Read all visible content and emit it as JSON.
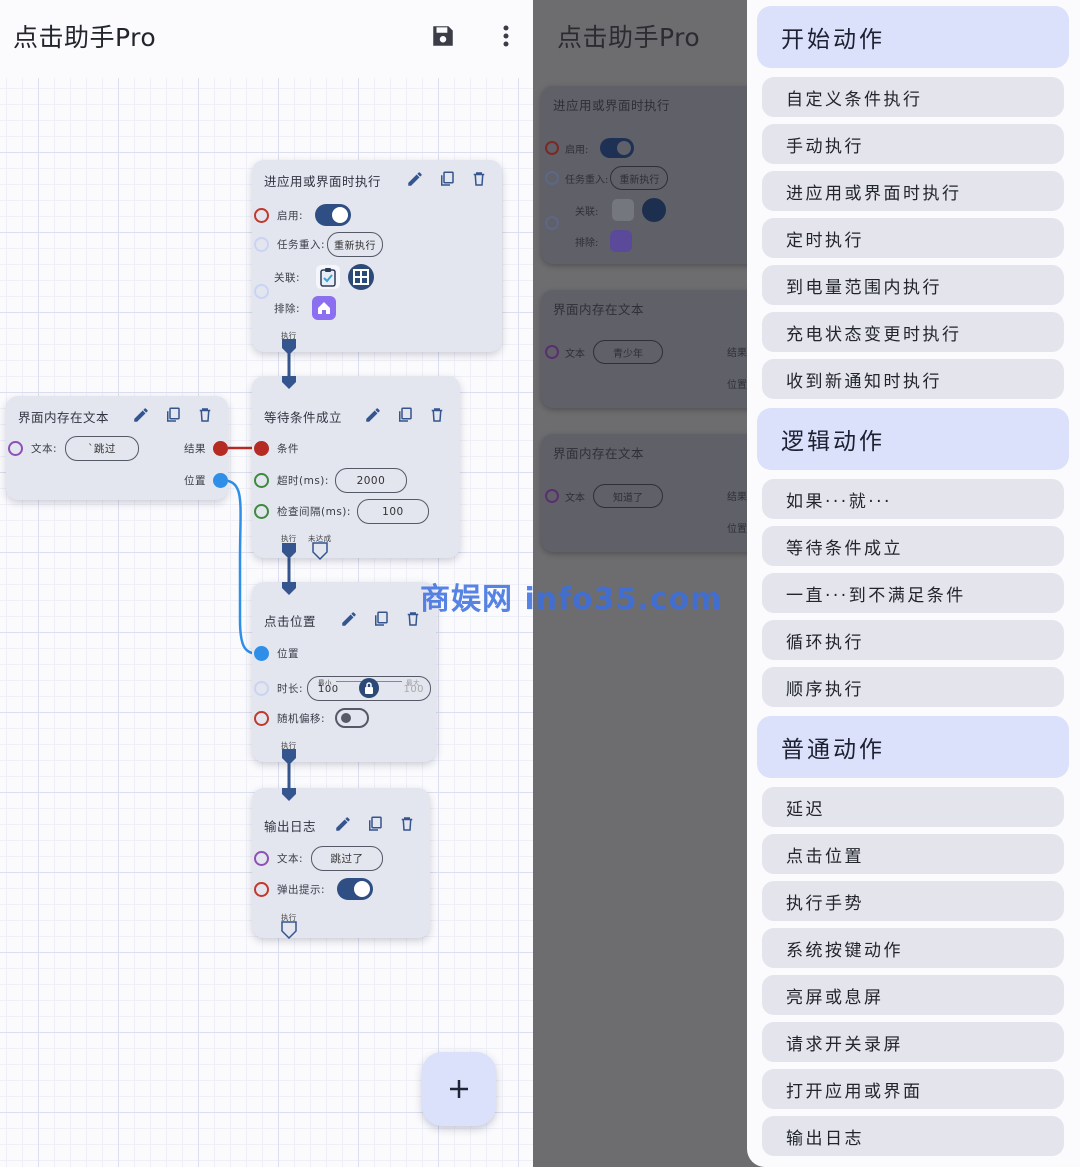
{
  "app": {
    "title": "点击助手Pro",
    "save_icon": "save-icon",
    "more_icon": "more-vert-icon"
  },
  "colors": {
    "accent": "#2f4f84",
    "drawer_header": "#dbe0fb",
    "red_port": "#c0392b",
    "blue_port": "#2f8fe8",
    "green_port": "#3d8a3d",
    "purple_port": "#8e4fb8"
  },
  "nodes": {
    "enter_app": {
      "title": "进应用或界面时执行",
      "enable_label": "启用:",
      "reentry_label": "任务重入:",
      "reentry_value": "重新执行",
      "related_label": "关联:",
      "exclude_label": "排除:",
      "exec_label": "执行"
    },
    "screen_text": {
      "title": "界面内存在文本",
      "text_label": "文本:",
      "text_value": "`跳过",
      "result_label": "结果",
      "position_label": "位置"
    },
    "wait": {
      "title": "等待条件成立",
      "condition_label": "条件",
      "timeout_label": "超时(ms):",
      "timeout_value": "2000",
      "interval_label": "检查间隔(ms):",
      "interval_value": "100",
      "exec_label": "执行",
      "fail_label": "未达成"
    },
    "click": {
      "title": "点击位置",
      "position_label": "位置",
      "duration_label": "时长:",
      "min_label": "最小",
      "max_label": "最大",
      "min_value": "100",
      "max_value": "100",
      "offset_label": "随机偏移:",
      "exec_label": "执行"
    },
    "log": {
      "title": "输出日志",
      "text_label": "文本:",
      "text_value": "跳过了",
      "popup_label": "弹出提示:",
      "exec_label": "执行"
    }
  },
  "fab": {
    "icon": "plus-icon"
  },
  "background_screen": {
    "title": "点击助手Pro",
    "node1": {
      "title": "进应用或界面时执行",
      "enable_label": "启用:",
      "reentry_label": "任务重入:",
      "reentry_value": "重新执行",
      "related_label": "关联:",
      "exclude_label": "排除:"
    },
    "node2": {
      "title": "界面内存在文本",
      "text_label": "文本",
      "text_value": "青少年",
      "result_label": "结果",
      "position_label": "位置"
    },
    "node3": {
      "title": "界面内存在文本",
      "text_label": "文本",
      "text_value": "知道了",
      "result_label": "结果",
      "position_label": "位置"
    }
  },
  "drawer": {
    "sections": [
      {
        "header": "开始动作",
        "items": [
          "自定义条件执行",
          "手动执行",
          "进应用或界面时执行",
          "定时执行",
          "到电量范围内执行",
          "充电状态变更时执行",
          "收到新通知时执行"
        ]
      },
      {
        "header": "逻辑动作",
        "items": [
          "如果···就···",
          "等待条件成立",
          "一直···到不满足条件",
          "循环执行",
          "顺序执行"
        ]
      },
      {
        "header": "普通动作",
        "items": [
          "延迟",
          "点击位置",
          "执行手势",
          "系统按键动作",
          "亮屏或息屏",
          "请求开关录屏",
          "打开应用或界面",
          "输出日志"
        ]
      }
    ]
  },
  "watermark": "商娱网 info35.com"
}
